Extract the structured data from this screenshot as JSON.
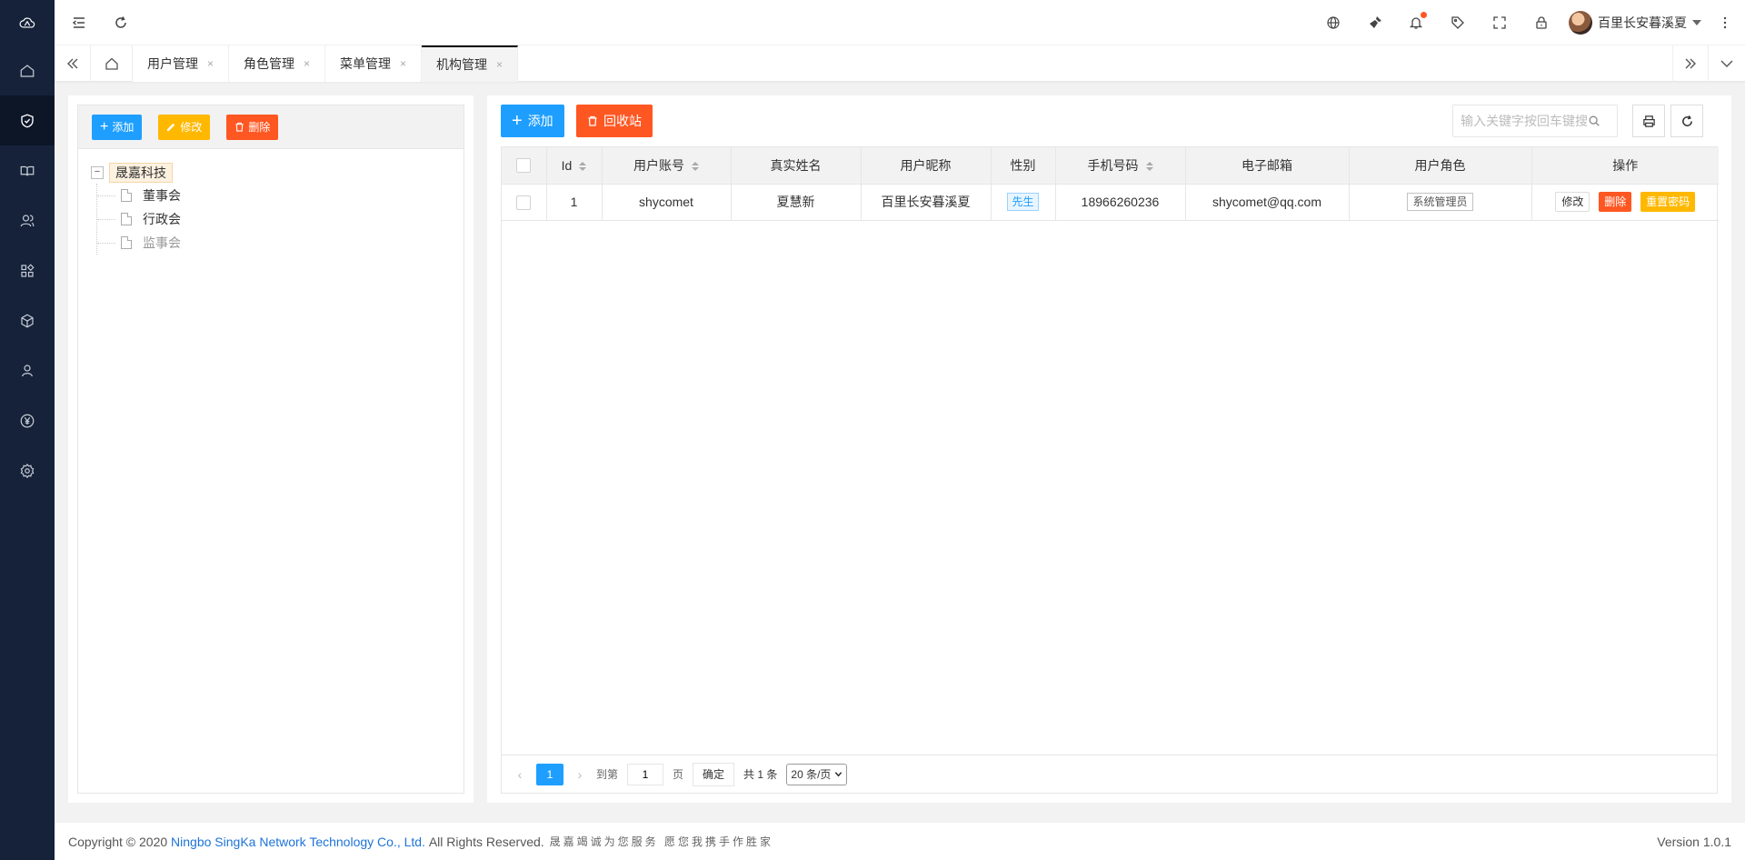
{
  "sidebar": {
    "items": [
      {
        "icon": "home-icon"
      },
      {
        "icon": "shield-check-icon",
        "active": true
      },
      {
        "icon": "book-icon"
      },
      {
        "icon": "users-icon"
      },
      {
        "icon": "apps-icon"
      },
      {
        "icon": "cube-icon"
      },
      {
        "icon": "user-icon"
      },
      {
        "icon": "yen-icon"
      },
      {
        "icon": "gear-icon"
      }
    ]
  },
  "header": {
    "user_name": "百里长安暮溪夏",
    "notification_dot_color": "#ff5722"
  },
  "tabs": [
    {
      "label": "用户管理",
      "close": "×"
    },
    {
      "label": "角色管理",
      "close": "×"
    },
    {
      "label": "菜单管理",
      "close": "×"
    },
    {
      "label": "机构管理",
      "close": "×",
      "active": true
    }
  ],
  "tree_panel": {
    "add_label": "添加",
    "edit_label": "修改",
    "delete_label": "删除",
    "toggle": "−",
    "root": "晟嘉科技",
    "children": [
      "董事会",
      "行政会",
      "监事会"
    ]
  },
  "main": {
    "add_label": "添加",
    "recycle_label": "回收站",
    "search_placeholder": "输入关键字按回车键搜索",
    "columns": [
      "Id",
      "用户账号",
      "真实姓名",
      "用户昵称",
      "性别",
      "手机号码",
      "电子邮箱",
      "用户角色",
      "操作"
    ],
    "rows": [
      {
        "id": "1",
        "account": "shycomet",
        "real_name": "夏慧新",
        "nickname": "百里长安暮溪夏",
        "gender": "先生",
        "phone": "18966260236",
        "email": "shycomet@qq.com",
        "role": "系统管理员"
      }
    ],
    "ops": {
      "edit": "修改",
      "delete": "删除",
      "reset": "重置密码"
    }
  },
  "pager": {
    "prev": "‹",
    "current": "1",
    "next": "›",
    "goto_prefix": "到第",
    "goto_value": "1",
    "goto_suffix": "页",
    "confirm": "确定",
    "total": "共 1 条",
    "page_size": "20 条/页"
  },
  "footer": {
    "copyright_prefix": "Copyright © 2020",
    "company": "Ningbo SingKa Network Technology Co., Ltd.",
    "rights": "All Rights Reserved.",
    "slogan": "晟嘉竭诚为您服务 愿您我携手作胜家",
    "version": "Version 1.0.1"
  },
  "colors": {
    "sidebar_bg": "#15223a",
    "primary_blue": "#1e9fff",
    "warn_orange": "#ffb800",
    "danger_red": "#ff5722"
  }
}
